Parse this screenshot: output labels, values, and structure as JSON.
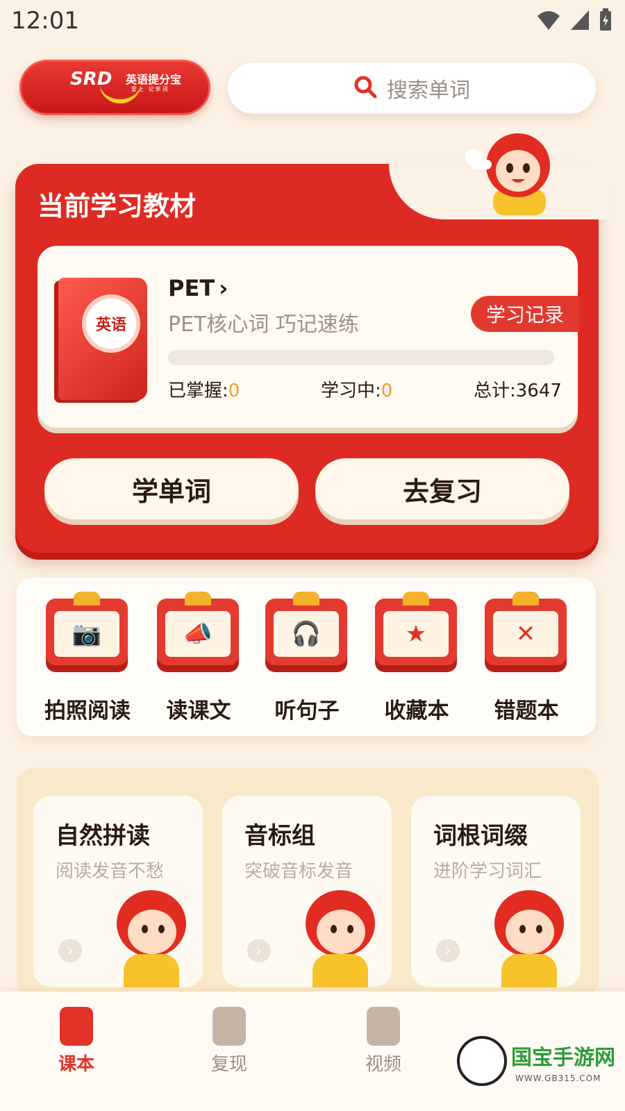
{
  "status_bar": {
    "time": "12:01"
  },
  "header": {
    "logo": {
      "brand": "SRD",
      "title": "英语提分宝",
      "subtitle": "爱上 记单词"
    },
    "search": {
      "placeholder": "搜索单词"
    }
  },
  "textbook": {
    "heading": "当前学习教材",
    "book_cover_label": "英语",
    "book_title": "PET",
    "book_subtitle": "PET核心词 巧记速练",
    "record_button": "学习记录",
    "progress_fraction": 0,
    "stats": {
      "mastered_label": "已掌握:",
      "mastered_value": "0",
      "learning_label": "学习中:",
      "learning_value": "0",
      "total_label": "总计:",
      "total_value": "3647"
    },
    "learn_button": "学单词",
    "review_button": "去复习"
  },
  "tools": [
    {
      "label": "拍照阅读",
      "icon": "camera-icon"
    },
    {
      "label": "读课文",
      "icon": "megaphone-icon"
    },
    {
      "label": "听句子",
      "icon": "headphones-icon"
    },
    {
      "label": "收藏本",
      "icon": "star-icon"
    },
    {
      "label": "错题本",
      "icon": "cross-icon"
    }
  ],
  "features": [
    {
      "title": "自然拼读",
      "subtitle": "阅读发音不愁"
    },
    {
      "title": "音标组",
      "subtitle": "突破音标发音"
    },
    {
      "title": "词根词缀",
      "subtitle": "进阶学习词汇"
    }
  ],
  "bottom_nav": [
    {
      "label": "课本",
      "icon": "textbook-icon",
      "active": true
    },
    {
      "label": "复现",
      "icon": "review-icon",
      "active": false
    },
    {
      "label": "视频",
      "icon": "video-icon",
      "active": false
    }
  ],
  "watermark": {
    "text": "国宝手游网",
    "url": "WWW.GB315.COM"
  },
  "colors": {
    "primary_red": "#dd2b23",
    "background": "#fbf1e4",
    "accent_orange": "#f29b2a"
  }
}
